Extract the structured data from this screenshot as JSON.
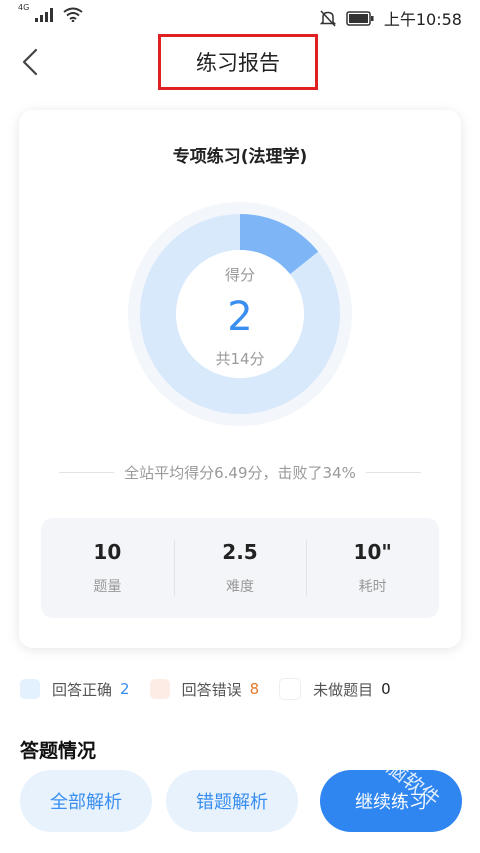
{
  "status_bar": {
    "network": "4G",
    "time": "上午10:58",
    "icons": [
      "signal-icon",
      "wifi-icon",
      "mute-icon",
      "battery-icon"
    ]
  },
  "header": {
    "title": "练习报告",
    "back_icon": "back-arrow-icon"
  },
  "report": {
    "title": "专项练习(法理学)",
    "score_label": "得分",
    "score": "2",
    "total": "共14分",
    "score_fraction": 0.142857,
    "compare_text": "全站平均得分6.49分，击败了34%",
    "stats": [
      {
        "value": "10",
        "label": "题量"
      },
      {
        "value": "2.5",
        "label": "难度"
      },
      {
        "value": "10\"",
        "label": "耗时"
      }
    ]
  },
  "legend": [
    {
      "label": "回答正确",
      "count": "2",
      "color": "#e3f0fd",
      "count_color": "#3a8ef0"
    },
    {
      "label": "回答错误",
      "count": "8",
      "color": "#fdece6",
      "count_color": "#e6782a"
    },
    {
      "label": "未做题目",
      "count": "0",
      "color": "#ffffff",
      "count_color": "#222222"
    }
  ],
  "section": {
    "title": "答题情况"
  },
  "buttons": {
    "all_analysis": "全部解析",
    "wrong_analysis": "错题解析",
    "continue": "继续练习"
  },
  "watermark": "电脑软件"
}
